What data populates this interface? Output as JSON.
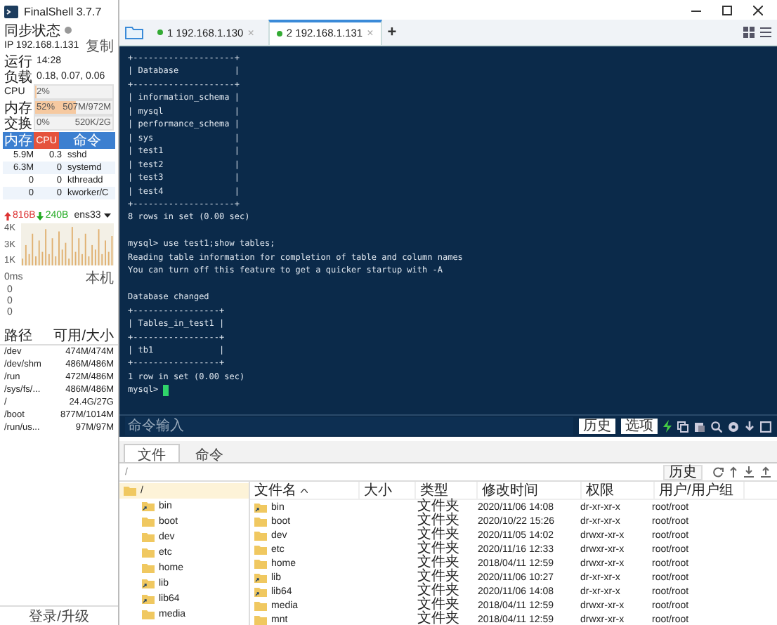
{
  "app": {
    "title": "FinalShell 3.7.7"
  },
  "status": {
    "sync_label": "同步状态",
    "ip": "IP 192.168.1.131",
    "copy": "复制",
    "uptime_label": "运行",
    "uptime": "14:28",
    "load_label": "负载",
    "load": "0.18, 0.07, 0.06"
  },
  "meters": [
    {
      "label": "CPU",
      "percent": "2%",
      "level": 0.02
    },
    {
      "label": "内存",
      "percent": "52%",
      "value": "507M/972M",
      "level": 0.52
    },
    {
      "label": "交换",
      "percent": "0%",
      "value": "520K/2G",
      "level": 0
    }
  ],
  "processes": {
    "columns": [
      {
        "label": "内存",
        "selected": false
      },
      {
        "label": "CPU",
        "selected": true
      },
      {
        "label": "命令",
        "selected": false
      }
    ],
    "rows": [
      [
        "5.9M",
        "0.3",
        "sshd"
      ],
      [
        "6.3M",
        "0",
        "systemd"
      ],
      [
        "0",
        "0",
        "kthreadd"
      ],
      [
        "0",
        "0",
        "kworker/C"
      ]
    ]
  },
  "network": {
    "upload": "816B",
    "download": "240B",
    "interface": "ens33",
    "y_labels": [
      "4K",
      "3K",
      "1K"
    ]
  },
  "ping": {
    "latency": "0ms",
    "target": "本机",
    "y_labels": [
      "0",
      "0",
      "0"
    ]
  },
  "disks": {
    "columns": [
      "路径",
      "可用/大小"
    ],
    "rows": [
      [
        "/dev",
        "474M/474M"
      ],
      [
        "/dev/shm",
        "486M/486M"
      ],
      [
        "/run",
        "472M/486M"
      ],
      [
        "/sys/fs/...",
        "486M/486M"
      ],
      [
        "/",
        "24.4G/27G"
      ],
      [
        "/boot",
        "877M/1014M"
      ],
      [
        "/run/us...",
        "97M/97M"
      ]
    ]
  },
  "login": "登录/升级",
  "tabs": [
    {
      "label": "1 192.168.1.130",
      "close": "×",
      "selected": false
    },
    {
      "label": "2 192.168.1.131",
      "close": "×",
      "selected": true
    }
  ],
  "new_tab": "+",
  "terminal": {
    "output": "+--------------------+\n| Database           |\n+--------------------+\n| information_schema |\n| mysql              |\n| performance_schema |\n| sys                |\n| test1              |\n| test2              |\n| test3              |\n| test4              |\n+--------------------+\n8 rows in set (0.00 sec)\n\nmysql> use test1;show tables;\nReading table information for completion of table and column names\nYou can turn off this feature to get a quicker startup with -A\n\nDatabase changed\n+-----------------+\n| Tables_in_test1 |\n+-----------------+\n| tb1             |\n+-----------------+\n1 row in set (0.00 sec)\n",
    "prompt": "mysql>"
  },
  "command_bar": {
    "placeholder": "命令输入",
    "buttons": [
      "历史",
      "选项"
    ]
  },
  "file_tabs": [
    {
      "label": "文件",
      "selected": true
    },
    {
      "label": "命令",
      "selected": false
    }
  ],
  "path_bar": {
    "path": "/",
    "history": "历史"
  },
  "tree": [
    {
      "name": "/",
      "selected": true,
      "children": [
        {
          "name": "bin",
          "link": true,
          "selected": false
        },
        {
          "name": "boot",
          "link": false,
          "selected": false
        },
        {
          "name": "dev",
          "link": false,
          "selected": false
        },
        {
          "name": "etc",
          "link": false,
          "selected": false
        },
        {
          "name": "home",
          "link": false,
          "selected": false
        },
        {
          "name": "lib",
          "link": true,
          "selected": false
        },
        {
          "name": "lib64",
          "link": true,
          "selected": false
        },
        {
          "name": "media",
          "link": false,
          "selected": false
        }
      ]
    }
  ],
  "files": {
    "columns": [
      "文件名",
      "大小",
      "类型",
      "修改时间",
      "权限",
      "用户/用户组"
    ],
    "rows": [
      {
        "name": "bin",
        "type": "文件夹",
        "modified": "2020/11/06 14:08",
        "permissions": "dr-xr-xr-x",
        "owner": "root/root",
        "link": true
      },
      {
        "name": "boot",
        "type": "文件夹",
        "modified": "2020/10/22 15:26",
        "permissions": "dr-xr-xr-x",
        "owner": "root/root",
        "link": false
      },
      {
        "name": "dev",
        "type": "文件夹",
        "modified": "2020/11/05 14:02",
        "permissions": "drwxr-xr-x",
        "owner": "root/root",
        "link": false
      },
      {
        "name": "etc",
        "type": "文件夹",
        "modified": "2020/11/16 12:33",
        "permissions": "drwxr-xr-x",
        "owner": "root/root",
        "link": false
      },
      {
        "name": "home",
        "type": "文件夹",
        "modified": "2018/04/11 12:59",
        "permissions": "drwxr-xr-x",
        "owner": "root/root",
        "link": false
      },
      {
        "name": "lib",
        "type": "文件夹",
        "modified": "2020/11/06 10:27",
        "permissions": "dr-xr-xr-x",
        "owner": "root/root",
        "link": true
      },
      {
        "name": "lib64",
        "type": "文件夹",
        "modified": "2020/11/06 14:08",
        "permissions": "dr-xr-xr-x",
        "owner": "root/root",
        "link": true
      },
      {
        "name": "media",
        "type": "文件夹",
        "modified": "2018/04/11 12:59",
        "permissions": "drwxr-xr-x",
        "owner": "root/root",
        "link": false
      },
      {
        "name": "mnt",
        "type": "文件夹",
        "modified": "2018/04/11 12:59",
        "permissions": "drwxr-xr-x",
        "owner": "root/root",
        "link": false
      }
    ]
  }
}
